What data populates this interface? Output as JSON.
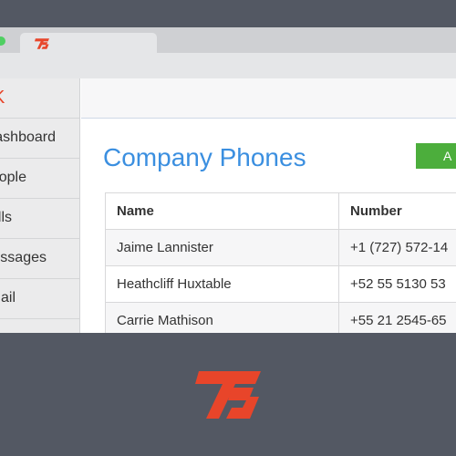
{
  "sidebar": {
    "brand": "K",
    "items": [
      {
        "label": "Dashboard"
      },
      {
        "label": "People"
      },
      {
        "label": "Calls"
      },
      {
        "label": "Messages"
      },
      {
        "label": "Email"
      }
    ]
  },
  "main": {
    "title": "Company Phones",
    "add_button_label": "A"
  },
  "table": {
    "headers": [
      "Name",
      "Number"
    ],
    "rows": [
      {
        "name": "Jaime Lannister",
        "number": "+1 (727) 572-14"
      },
      {
        "name": "Heathcliff Huxtable",
        "number": "+52 55 5130 53"
      },
      {
        "name": "Carrie Mathison",
        "number": "+55 21 2545-65"
      }
    ]
  },
  "colors": {
    "background": "#535863",
    "accent_blue": "#3b8fe0",
    "brand_red": "#e8452a",
    "add_green": "#4cae3c"
  },
  "icons": {
    "tab_favicon": "brand-logo-icon",
    "footer_logo": "brand-logo-icon"
  }
}
